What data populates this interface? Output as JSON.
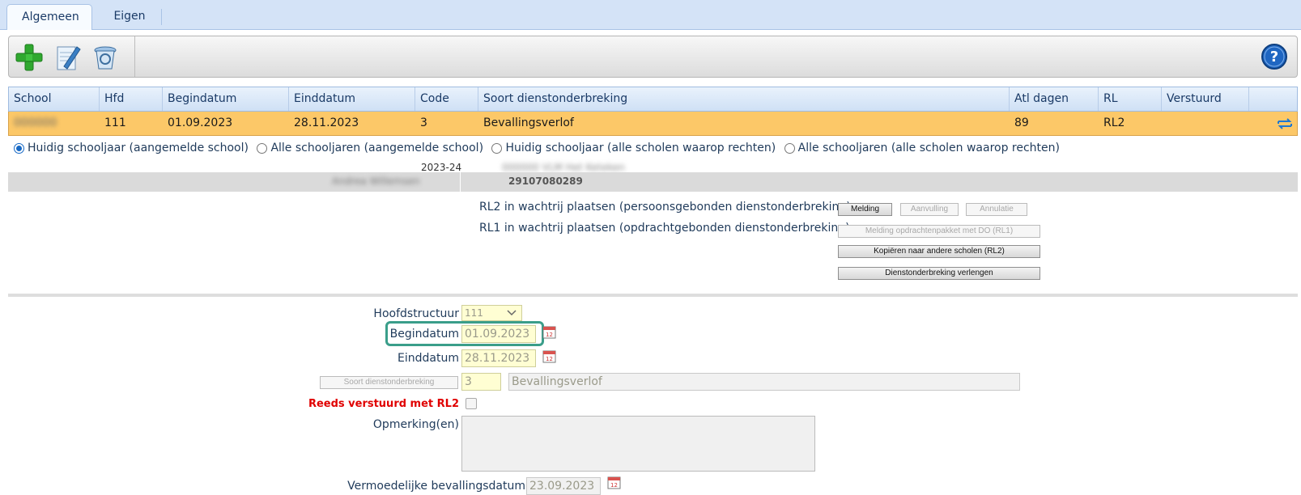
{
  "tabs": [
    {
      "label": "Algemeen",
      "active": true
    },
    {
      "label": "Eigen",
      "active": false
    }
  ],
  "toolbar": {
    "icons": [
      "add-icon",
      "edit-icon",
      "delete-icon",
      "help-icon"
    ]
  },
  "grid": {
    "headers": [
      "School",
      "Hfd",
      "Begindatum",
      "Einddatum",
      "Code",
      "Soort dienstonderbreking",
      "Atl dagen",
      "RL",
      "Verstuurd"
    ],
    "row": {
      "school": "000000",
      "hfd": "111",
      "begindatum": "01.09.2023",
      "einddatum": "28.11.2023",
      "code": "3",
      "soort": "Bevallingsverlof",
      "atl_dagen": "89",
      "rl": "RL2",
      "verstuurd": ""
    }
  },
  "radios": [
    {
      "label": "Huidig schooljaar (aangemelde school)",
      "checked": true
    },
    {
      "label": "Alle schooljaren (aangemelde school)",
      "checked": false
    },
    {
      "label": "Huidig schooljaar (alle scholen waarop rechten)",
      "checked": false
    },
    {
      "label": "Alle schooljaren (alle scholen waarop rechten)",
      "checked": false
    }
  ],
  "schoolyear": "2023-24",
  "schoolyear_extra": "000000 VLM Het Keteken",
  "info": {
    "label": "Andrea Willemsen",
    "number": "29107080289"
  },
  "rl2_line": "RL2 in wachtrij plaatsen (persoonsgebonden dienstonderbreking)",
  "rl1_line": "RL1 in wachtrij plaatsen (opdrachtgebonden dienstonderbreking)",
  "buttons": {
    "melding": "Melding",
    "aanvulling": "Aanvulling",
    "annulatie": "Annulatie",
    "melding_rl1": "Melding opdrachtenpakket met DO (RL1)",
    "kopieren": "Kopiëren naar andere scholen (RL2)",
    "verlengen": "Dienstonderbreking verlengen",
    "soort": "Soort dienstonderbreking"
  },
  "form": {
    "hoofdstructuur_label": "Hoofdstructuur",
    "hoofdstructuur_value": "111",
    "begindatum_label": "Begindatum",
    "begindatum_value": "01.09.2023",
    "einddatum_label": "Einddatum",
    "einddatum_value": "28.11.2023",
    "code_value": "3",
    "soort_value": "Bevallingsverlof",
    "reeds_label": "Reeds verstuurd met RL2",
    "opmerking_label": "Opmerking(en)",
    "vermoedelijke_label": "Vermoedelijke bevallingsdatum",
    "vermoedelijke_value": "23.09.2023"
  },
  "colors": {
    "selected_row": "#fcc868",
    "highlight_box": "#3a9e8a",
    "reeds_label": "#e00000"
  }
}
